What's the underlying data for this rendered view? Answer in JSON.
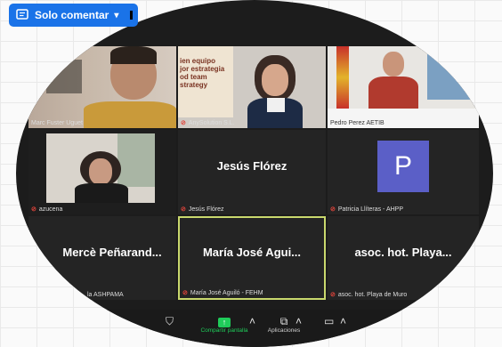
{
  "doc": {
    "comment_mode_button": "Solo comentar"
  },
  "participants": [
    {
      "display": "",
      "label": "Marc Fuster Uguet",
      "muted": false,
      "video": true
    },
    {
      "display": "",
      "label": "AnySolution S.L.",
      "muted": true,
      "video": true,
      "slide_text": "ien equipo\njor estrategia\nod team\nstrategy"
    },
    {
      "display": "",
      "label": "Pedro Perez AETIB",
      "muted": true,
      "video": true
    },
    {
      "display": "",
      "label": "azucena",
      "muted": true,
      "video": true
    },
    {
      "display": "Jesús Flórez",
      "label": "Jesús Flórez",
      "muted": true,
      "video": false
    },
    {
      "display": "P",
      "label": "Patricia Llíteras - AHPP",
      "muted": true,
      "video": false,
      "avatar_color": "#5b5fc7"
    },
    {
      "display": "Mercè Peñarand...",
      "label": "la ASHPAMA",
      "muted": true,
      "video": false
    },
    {
      "display": "María José Agui...",
      "label": "María José Aguiló - FEHM",
      "muted": true,
      "video": false,
      "active_speaker": true
    },
    {
      "display": "asoc. hot. Playa...",
      "label": "asoc. hot. Playa de Muro",
      "muted": true,
      "video": false
    }
  ],
  "toolbar": {
    "share_label": "Compartir pantalla",
    "apps_label": "Aplicaciones"
  },
  "colors": {
    "accent": "#1a73e8",
    "share_green": "#1fcc5a",
    "active_border": "#c9d86d",
    "muted_red": "#e0443b"
  }
}
